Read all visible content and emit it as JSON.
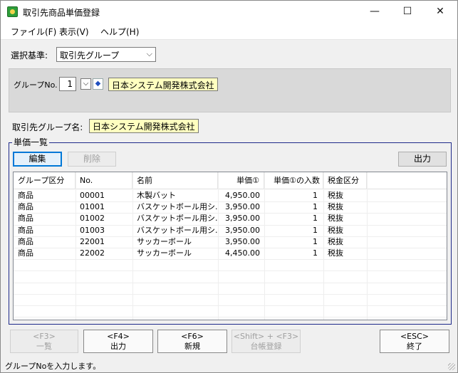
{
  "window": {
    "title": "取引先商品単価登録",
    "minimize_glyph": "—",
    "maximize_glyph": "☐",
    "close_glyph": "✕"
  },
  "menu": [
    "ファイル(F)",
    "表示(V)",
    "ヘルプ(H)"
  ],
  "selection": {
    "label": "選択基準:",
    "value": "取引先グループ"
  },
  "group": {
    "no_label": "グループNo.",
    "no_value": "1",
    "name_value": "日本システム開発株式会社"
  },
  "group_name": {
    "label": "取引先グループ名:",
    "value": "日本システム開発株式会社"
  },
  "price_list": {
    "title": "単価一覧",
    "edit_button": "編集",
    "delete_button": "削除",
    "output_button": "出力",
    "columns": [
      "グループ区分",
      "No.",
      "名前",
      "単価①",
      "単価①の入数",
      "税金区分"
    ],
    "rows": [
      [
        "商品",
        "00001",
        "木製バット",
        "4,950.00",
        "1",
        "税抜"
      ],
      [
        "商品",
        "01001",
        "バスケットボール用シ...",
        "3,950.00",
        "1",
        "税抜"
      ],
      [
        "商品",
        "01002",
        "バスケットボール用シ...",
        "3,950.00",
        "1",
        "税抜"
      ],
      [
        "商品",
        "01003",
        "バスケットボール用シ...",
        "3,950.00",
        "1",
        "税抜"
      ],
      [
        "商品",
        "22001",
        "サッカーボール",
        "3,950.00",
        "1",
        "税抜"
      ],
      [
        "商品",
        "22002",
        "サッカーボール",
        "4,450.00",
        "1",
        "税抜"
      ]
    ]
  },
  "fkeys": [
    {
      "key": "<F3>",
      "label": "一覧",
      "enabled": false
    },
    {
      "key": "<F4>",
      "label": "出力",
      "enabled": true
    },
    {
      "key": "<F6>",
      "label": "新規",
      "enabled": true
    },
    {
      "key": "<Shift> + <F3>",
      "label": "台帳登録",
      "enabled": false
    },
    {
      "key": "<ESC>",
      "label": "終了",
      "enabled": true
    }
  ],
  "status": "グループNoを入力します。"
}
